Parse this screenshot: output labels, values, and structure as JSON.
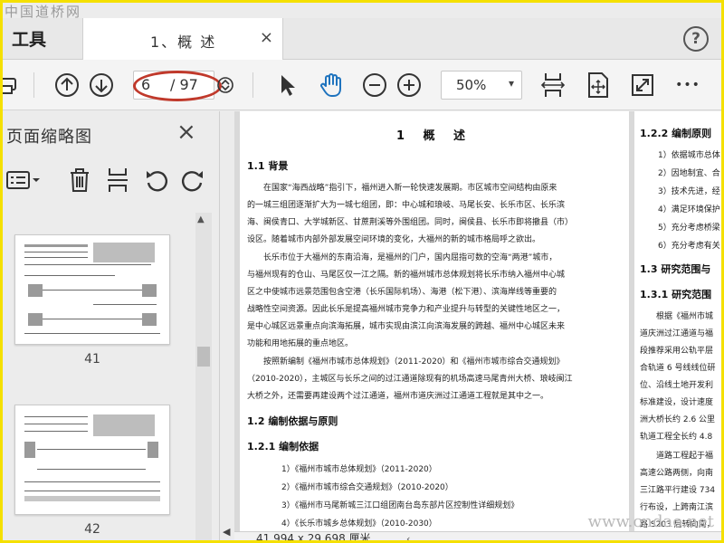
{
  "watermarks": {
    "top": "中国道桥网",
    "bottom": "www.cndao.net"
  },
  "tabs": {
    "tools_label": "工具",
    "document_title": "1、概 述",
    "close_symbol": "×",
    "help_symbol": "?"
  },
  "toolbar": {
    "current_page": "6",
    "total_pages": "/ 97",
    "zoom": "50%",
    "zoom_caret": "▾",
    "more_symbol": "•••",
    "icons": [
      "print-icon",
      "prev-page-icon",
      "next-page-icon",
      "page-stepper-icon",
      "select-cursor-icon",
      "hand-tool-icon",
      "zoom-out-icon",
      "zoom-in-icon",
      "fit-width-icon",
      "fit-page-icon",
      "full-screen-icon",
      "more-icon"
    ],
    "accent_color": "#1e73be",
    "highlight_color": "#c0392b"
  },
  "left_panel": {
    "title": "页面缩略图",
    "close_symbol": "×",
    "thumbnails": [
      {
        "label": "41"
      },
      {
        "label": "42"
      }
    ]
  },
  "document": {
    "title": "1 概 述",
    "sections": {
      "s1_1": "1.1 背景",
      "s1_2": "1.2 编制依据与原则",
      "s1_2_1": "1.2.1 编制依据"
    },
    "paragraph1": [
      "在国家“海西战略”指引下，福州进入新一轮快速发展期。市区城市空间结构由原来",
      "的一城三组团逐渐扩大为一城七组团，即：中心城和琅岐、马尾长安、长乐市区、长乐滨",
      "海、闽侯青口、大学城新区、甘蔗荆溪等外围组团。同时，闽侯县、长乐市即将撤县（市）",
      "设区。随着城市内部外部发展空间环境的变化，大福州的新的城市格局呼之欲出。"
    ],
    "paragraph2": [
      "长乐市位于大福州的东南沿海，是福州的门户，国内屈指可数的空海“两港”城市，",
      "与福州现有的仓山、马尾区仅一江之隔。新的福州城市总体规划将长乐市纳入福州中心城",
      "区之中使城市远景范围包含空港（长乐国际机场）、海港（松下港）、滨海岸线等重要的",
      "战略性空间资源。因此长乐是提高福州城市竞争力和产业提升与转型的关键性地区之一，",
      "是中心城区远景重点向滨海拓展，城市实现由滨江向滨海发展的跨越、福州中心城区未来",
      "功能和用地拓展的重点地区。"
    ],
    "paragraph3": [
      "按照新编制《福州市城市总体规划》（2011-2020）和《福州市城市综合交通规划》",
      "（2010-2020），主城区与长乐之间的过江通道除现有的机场高速马尾青州大桥、琅岐闽江",
      "大桥之外，还需要再建设两个过江通道，福州市道庆洲过江通道工程就是其中之一。"
    ],
    "basis_list": [
      "1）《福州市城市总体规划》（2011-2020）",
      "2）《福州市城市综合交通规划》（2010-2020）",
      "3）《福州市马尾新城三江口组团南台岛东部片区控制性详细规划》",
      "4）《长乐市城乡总体规划》（2010-2030）"
    ]
  },
  "page2": {
    "h_1_2_2": "1.2.2 编制原则",
    "principles": [
      "1）依据城市总体",
      "2）因地制宜、合",
      "3）技术先进，经",
      "4）满足环境保护",
      "5）充分考虑桥梁",
      "6）充分考虑有关"
    ],
    "h_1_3": "1.3 研究范围与",
    "h_1_3_1": "1.3.1 研究范围",
    "para": [
      "根据《福州市城",
      "道庆洲过江通道与福",
      "段推荐采用公轨平层",
      "合轨道 6 号线线位研",
      "位、沿线土地开发利",
      "标准建设，设计速度",
      "洲大桥长约 2.6 公里",
      "轨道工程全长约 4.8"
    ],
    "para2": [
      "道路工程起于福",
      "高速公路两侧，向南",
      "三江路平行建设 734",
      "行布设，上跨南江滨",
      "路 S203 后转向南，"
    ]
  },
  "status": {
    "page_size": "41.994 x 29.698 厘米",
    "arrow": "‹"
  }
}
